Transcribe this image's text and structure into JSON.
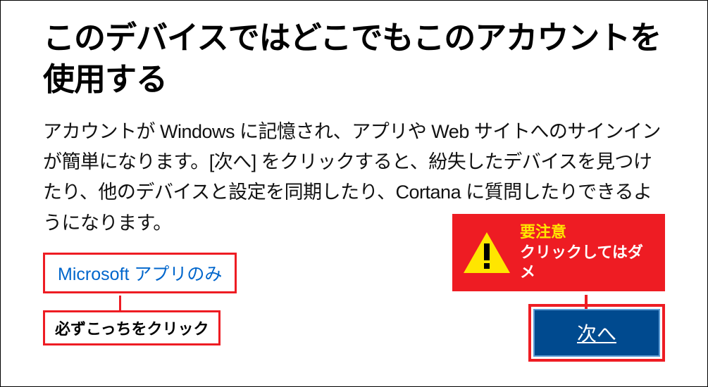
{
  "dialog": {
    "title": "このデバイスではどこでもこのアカウントを使用する",
    "description": "アカウントが Windows に記憶され、アプリや Web サイトへのサインインが簡単になります。[次へ] をクリックすると、紛失したデバイスを見つけたり、他のデバイスと設定を同期したり、Cortana に質問したりできるようになります。",
    "apps_only_link": "Microsoft アプリのみ",
    "next_button": "次へ"
  },
  "annotation": {
    "left_label": "必ずこっちをクリック",
    "warning_title": "要注意",
    "warning_message": "クリックしてはダメ"
  },
  "colors": {
    "highlight": "#ee1c23",
    "link": "#0066cc",
    "button_bg": "#004a8f",
    "warning_title": "#ffe600"
  }
}
